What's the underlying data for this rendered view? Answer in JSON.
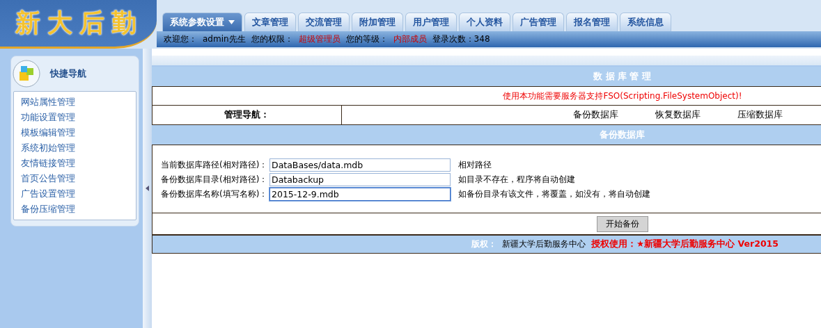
{
  "logo": {
    "text": "新大后勤"
  },
  "tabs": [
    {
      "label": "系统参数设置",
      "selected": true,
      "caret": true
    },
    {
      "label": "文章管理",
      "selected": false
    },
    {
      "label": "交流管理",
      "selected": false
    },
    {
      "label": "附加管理",
      "selected": false
    },
    {
      "label": "用户管理",
      "selected": false
    },
    {
      "label": "个人资料",
      "selected": false
    },
    {
      "label": "广告管理",
      "selected": false
    },
    {
      "label": "报名管理",
      "selected": false
    },
    {
      "label": "系统信息",
      "selected": false
    }
  ],
  "welcome_bar": [
    {
      "text": "欢迎您：",
      "highlight": false
    },
    {
      "text": "admin先生",
      "highlight": false
    },
    {
      "text": "您的权限：",
      "highlight": false
    },
    {
      "text": "超级管理员",
      "highlight": true
    },
    {
      "text": "您的等级：",
      "highlight": false
    },
    {
      "text": "内部成员",
      "highlight": true
    },
    {
      "text": "登录次数：348",
      "highlight": false
    }
  ],
  "sidebar": {
    "title": "快捷导航",
    "items": [
      "网站属性管理",
      "功能设置管理",
      "模板编辑管理",
      "系统初始管理",
      "友情链接管理",
      "首页公告管理",
      "广告设置管理",
      "备份压缩管理"
    ]
  },
  "main": {
    "title": "数 据 库 管 理",
    "notice": "使用本功能需要服务器支持FSO(Scripting.FileSystemObject)!",
    "nav_label": "管理导航：",
    "nav_links": [
      "备份数据库",
      "恢复数据库",
      "压缩数据库"
    ],
    "section_title": "备份数据库",
    "fields": [
      {
        "label": "当前数据库路径(相对路径)：",
        "value": "DataBases/data.mdb",
        "hint": "相对路径",
        "focused": false
      },
      {
        "label": "备份数据库目录(相对路径)：",
        "value": "Databackup",
        "hint": "如目录不存在，程序将自动创建",
        "focused": false
      },
      {
        "label": "备份数据库名称(填写名称)：",
        "value": "2015-12-9.mdb",
        "hint": "如备份目录有该文件，将覆盖，如没有，将自动创建",
        "focused": true
      }
    ],
    "submit": "开始备份",
    "footer": {
      "label": "版权：",
      "owner": "新疆大学后勤服务中心",
      "license": "授权使用：★新疆大学后勤服务中心 Ver2015"
    }
  }
}
